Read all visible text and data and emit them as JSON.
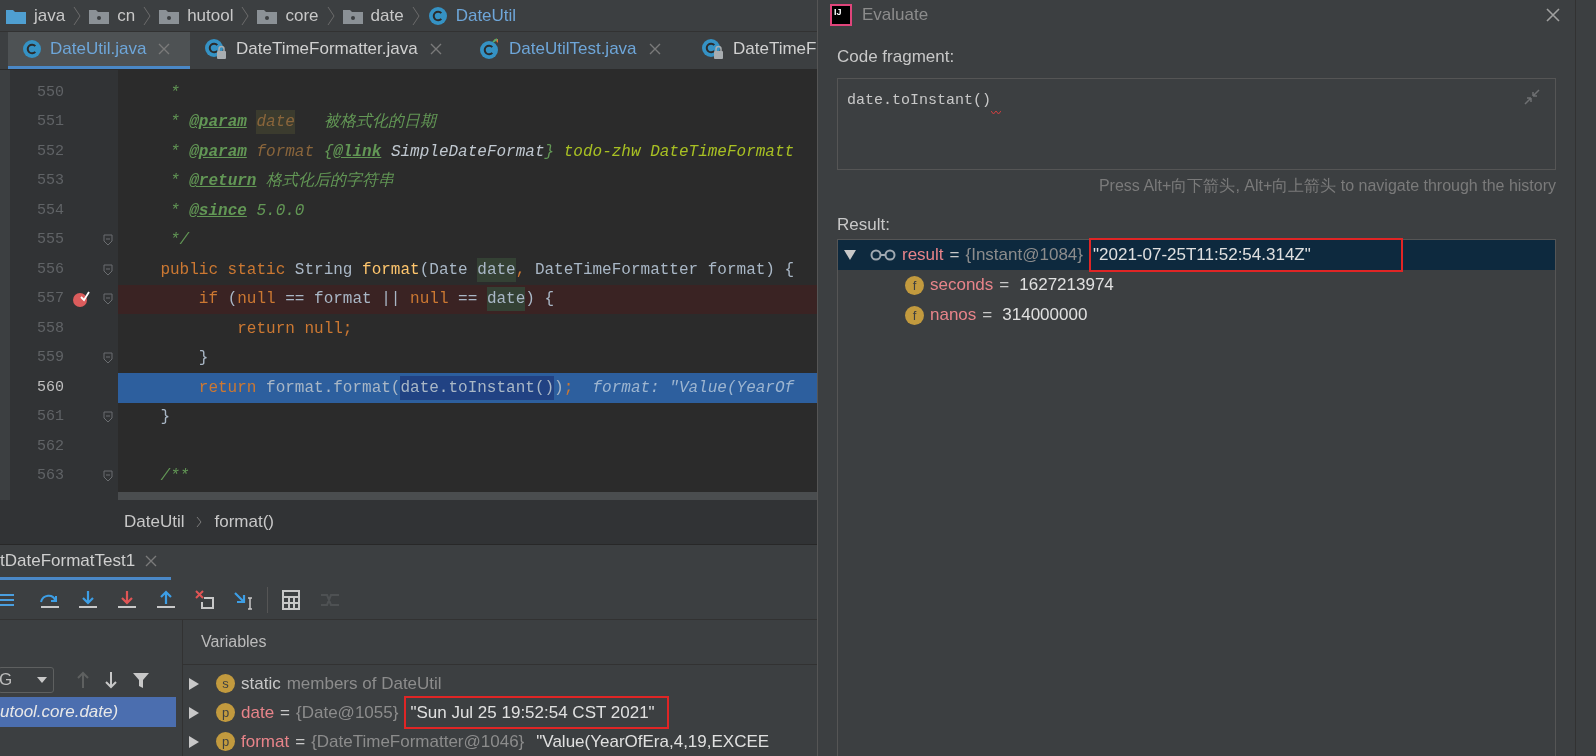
{
  "breadcrumbs": [
    {
      "kind": "folder",
      "label": "java"
    },
    {
      "kind": "package",
      "label": "cn"
    },
    {
      "kind": "package",
      "label": "hutool"
    },
    {
      "kind": "package",
      "label": "core"
    },
    {
      "kind": "package",
      "label": "date"
    },
    {
      "kind": "class",
      "label": "DateUtil"
    }
  ],
  "editor_tabs": [
    {
      "kind": "class",
      "label": "DateUtil.java",
      "selected": true,
      "closable": true
    },
    {
      "kind": "library",
      "label": "DateTimeFormatter.java",
      "selected": false,
      "closable": true
    },
    {
      "kind": "test",
      "label": "DateUtilTest.java",
      "selected": false,
      "closable": true
    },
    {
      "kind": "library",
      "label": "DateTimeF",
      "selected": false,
      "closable": false
    }
  ],
  "code_lines": [
    {
      "number": "550",
      "kind": "normal",
      "fold_marker": false,
      "segments": [
        {
          "kind": "comment",
          "text": "     *"
        }
      ]
    },
    {
      "number": "551",
      "kind": "normal",
      "fold_marker": false,
      "segments": [
        {
          "kind": "comment",
          "text": "     * "
        },
        {
          "kind": "doctag",
          "text": "@param"
        },
        {
          "kind": "docparam_usage",
          "text": " date"
        },
        {
          "kind": "comment",
          "text": "   被格式化的日期"
        }
      ]
    },
    {
      "number": "552",
      "kind": "normal",
      "fold_marker": false,
      "segments": [
        {
          "kind": "comment",
          "text": "     * "
        },
        {
          "kind": "doctag",
          "text": "@param"
        },
        {
          "kind": "docparam",
          "text": " format"
        },
        {
          "kind": "comment",
          "text": " {"
        },
        {
          "kind": "doctag",
          "text": "@link"
        },
        {
          "kind": "doclink",
          "text": " SimpleDateFormat"
        },
        {
          "kind": "comment",
          "text": "}"
        },
        {
          "kind": "todo",
          "text": " todo-zhw DateTimeFormatt"
        }
      ]
    },
    {
      "number": "553",
      "kind": "normal",
      "fold_marker": false,
      "segments": [
        {
          "kind": "comment",
          "text": "     * "
        },
        {
          "kind": "doctag",
          "text": "@return"
        },
        {
          "kind": "comment",
          "text": " 格式化后的字符串"
        }
      ]
    },
    {
      "number": "554",
      "kind": "normal",
      "fold_marker": false,
      "segments": [
        {
          "kind": "comment",
          "text": "     * "
        },
        {
          "kind": "doctag",
          "text": "@since"
        },
        {
          "kind": "comment",
          "text": " 5.0.0"
        }
      ]
    },
    {
      "number": "555",
      "kind": "normal",
      "fold_marker": true,
      "segments": [
        {
          "kind": "comment",
          "text": "     */"
        }
      ]
    },
    {
      "number": "556",
      "kind": "normal",
      "fold_marker": true,
      "segments": [
        {
          "kind": "keyword",
          "text": "    public static"
        },
        {
          "kind": "plain",
          "text": " String "
        },
        {
          "kind": "method",
          "text": "format"
        },
        {
          "kind": "plain",
          "text": "(Date "
        },
        {
          "kind": "usage",
          "text": "date"
        },
        {
          "kind": "keyword",
          "text": ","
        },
        {
          "kind": "plain",
          "text": " DateTimeFormatter format) {"
        }
      ]
    },
    {
      "number": "557",
      "kind": "breakpoint",
      "fold_marker": true,
      "segments": [
        {
          "kind": "keyword",
          "text": "        if"
        },
        {
          "kind": "plain",
          "text": " ("
        },
        {
          "kind": "keyword",
          "text": "null"
        },
        {
          "kind": "plain",
          "text": " == format || "
        },
        {
          "kind": "keyword",
          "text": "null"
        },
        {
          "kind": "plain",
          "text": " == "
        },
        {
          "kind": "usage",
          "text": "date"
        },
        {
          "kind": "plain",
          "text": ") {"
        }
      ]
    },
    {
      "number": "558",
      "kind": "normal",
      "fold_marker": false,
      "segments": [
        {
          "kind": "keyword",
          "text": "            return null;"
        }
      ]
    },
    {
      "number": "559",
      "kind": "normal",
      "fold_marker": true,
      "segments": [
        {
          "kind": "plain",
          "text": "        }"
        }
      ]
    },
    {
      "number": "560",
      "kind": "execution",
      "fold_marker": false,
      "segments": [
        {
          "kind": "keyword",
          "text": "        return"
        },
        {
          "kind": "plain",
          "text": " format.format("
        },
        {
          "kind": "selection",
          "text": "date.toInstant()"
        },
        {
          "kind": "plain",
          "text": ")"
        },
        {
          "kind": "keyword",
          "text": ";"
        },
        {
          "kind": "hint",
          "text": "  format: \"Value(YearOf"
        }
      ]
    },
    {
      "number": "561",
      "kind": "normal",
      "fold_marker": true,
      "segments": [
        {
          "kind": "plain",
          "text": "    }"
        }
      ]
    },
    {
      "number": "562",
      "kind": "normal",
      "fold_marker": false
    },
    {
      "number": "563",
      "kind": "normal",
      "fold_marker": true,
      "segments": [
        {
          "kind": "comment",
          "text": "    /**"
        }
      ]
    }
  ],
  "navigation_bar": [
    "DateUtil",
    "format()"
  ],
  "debug": {
    "tab": {
      "label": "tDateFormatTest1",
      "closable": true
    },
    "toolbar": [
      {
        "kind": "layout",
        "disabled": false
      },
      {
        "kind": "step_over",
        "disabled": false
      },
      {
        "kind": "step_into",
        "disabled": false
      },
      {
        "kind": "force_step_into",
        "disabled": false
      },
      {
        "kind": "step_out",
        "disabled": false
      },
      {
        "kind": "drop_frame",
        "disabled": false
      },
      {
        "kind": "run_to_cursor",
        "disabled": false
      },
      {
        "kind": "evaluate",
        "disabled": false
      },
      {
        "kind": "trace",
        "disabled": true
      }
    ],
    "thread_dropdown": "G",
    "frames": [
      {
        "label": "utool.core.date)",
        "selected": true
      }
    ],
    "variables_header": "Variables",
    "variables": [
      {
        "kind": "static",
        "badge": "s",
        "name": "static",
        "type": "members of DateUtil"
      },
      {
        "kind": "field",
        "badge": "p",
        "name": "date",
        "separator": "=",
        "type": "{Date@1055}",
        "value": "\"Sun Jul 25 19:52:54 CST 2021\"",
        "outlined": true
      },
      {
        "kind": "field",
        "badge": "p",
        "name": "format",
        "separator": "=",
        "type": "{DateTimeFormatter@1046}",
        "value": "\"Value(YearOfEra,4,19,EXCEE",
        "outlined": false
      }
    ]
  },
  "evaluate_dialog": {
    "app_logo": "IJ",
    "title": "Evaluate",
    "code_label": "Code fragment:",
    "code": "date.toInstant()",
    "hint": "Press Alt+向下箭头, Alt+向上箭头 to navigate through the history",
    "result_label": "Result:",
    "result_tree": [
      {
        "kind": "watch",
        "name": "result",
        "separator": "=",
        "type": "{Instant@1084}",
        "value": "\"2021-07-25T11:52:54.314Z\"",
        "expanded": true,
        "selected": true,
        "outlined": true,
        "children": [
          {
            "kind": "field",
            "badge": "f",
            "name": "seconds",
            "separator": "=",
            "value": "1627213974",
            "selected": false,
            "outlined": false
          },
          {
            "kind": "field",
            "badge": "f",
            "name": "nanos",
            "separator": "=",
            "value": "314000000",
            "selected": false,
            "outlined": false
          }
        ]
      }
    ]
  }
}
